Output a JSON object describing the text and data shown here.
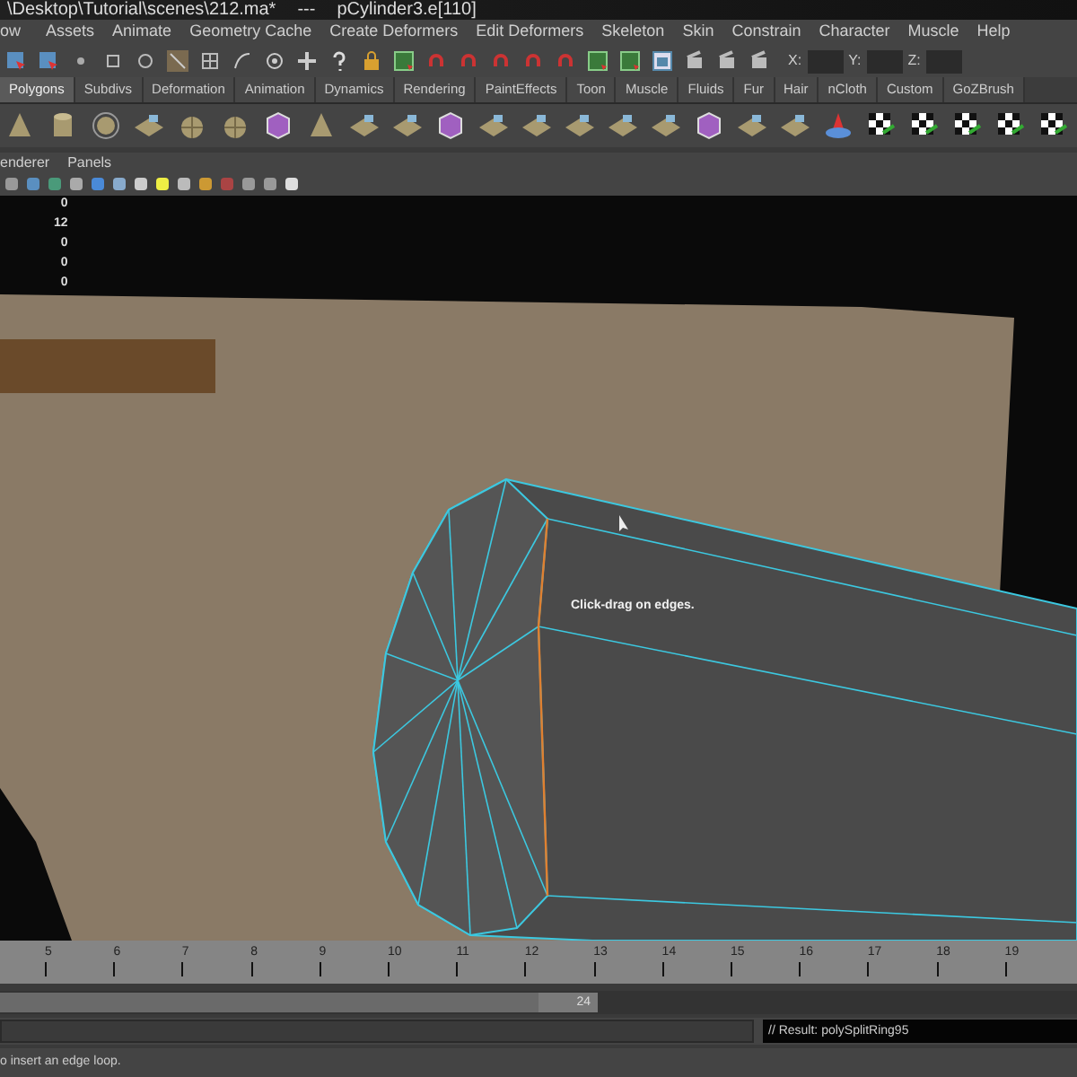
{
  "window": {
    "title_path": "\\Desktop\\Tutorial\\scenes\\212.ma*",
    "title_separator": "---",
    "title_selection": "pCylinder3.e[110]"
  },
  "menu_bar": [
    "ow",
    "Assets",
    "Animate",
    "Geometry Cache",
    "Create Deformers",
    "Edit Deformers",
    "Skeleton",
    "Skin",
    "Constrain",
    "Character",
    "Muscle",
    "Help"
  ],
  "status_line": {
    "fields": [
      {
        "label": "X:"
      },
      {
        "label": "Y:"
      },
      {
        "label": "Z:"
      }
    ]
  },
  "shelf_tabs": [
    {
      "label": "Polygons",
      "selected": true
    },
    {
      "label": "Subdivs",
      "selected": false
    },
    {
      "label": "Deformation",
      "selected": false
    },
    {
      "label": "Animation",
      "selected": false
    },
    {
      "label": "Dynamics",
      "selected": false
    },
    {
      "label": "Rendering",
      "selected": false
    },
    {
      "label": "PaintEffects",
      "selected": false
    },
    {
      "label": "Toon",
      "selected": false
    },
    {
      "label": "Muscle",
      "selected": false
    },
    {
      "label": "Fluids",
      "selected": false
    },
    {
      "label": "Fur",
      "selected": false
    },
    {
      "label": "Hair",
      "selected": false
    },
    {
      "label": "nCloth",
      "selected": false
    },
    {
      "label": "Custom",
      "selected": false
    },
    {
      "label": "GoZBrush",
      "selected": false
    }
  ],
  "panel_menu": [
    "enderer",
    "Panels"
  ],
  "viewport": {
    "hud_values": [
      "0",
      "12",
      "0",
      "0",
      "0"
    ],
    "tooltip": "Click-drag on edges."
  },
  "timeline": {
    "ticks": [
      "5",
      "6",
      "7",
      "8",
      "9",
      "10",
      "11",
      "12",
      "13",
      "14",
      "15",
      "16",
      "17",
      "18",
      "19"
    ]
  },
  "range_slider": {
    "end_time": "24"
  },
  "command_line": {
    "result": "// Result: polySplitRing95"
  },
  "help_line": "o insert an edge loop."
}
